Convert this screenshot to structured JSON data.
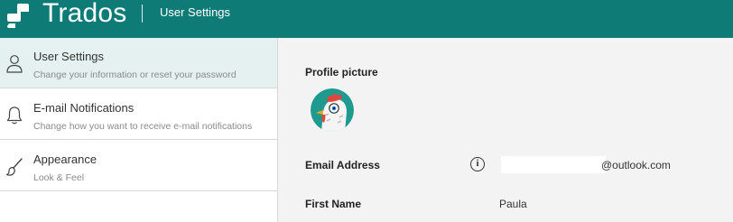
{
  "header": {
    "brand": "Trados",
    "app_title": "User Settings",
    "colors": {
      "bar": "#0f7b77"
    }
  },
  "sidebar": {
    "items": [
      {
        "label": "User Settings",
        "description": "Change your information or reset your password",
        "icon": "user-icon",
        "active": true
      },
      {
        "label": "E-mail Notifications",
        "description": "Change how you want to receive e-mail notifications",
        "icon": "bell-icon",
        "active": false
      },
      {
        "label": "Appearance",
        "description": "Look & Feel",
        "icon": "paintbrush-icon",
        "active": false
      }
    ]
  },
  "main": {
    "profile_picture_label": "Profile picture",
    "email_label": "Email Address",
    "email_value_visible": "@outlook.com",
    "first_name_label": "First Name",
    "first_name_value": "Paula"
  }
}
